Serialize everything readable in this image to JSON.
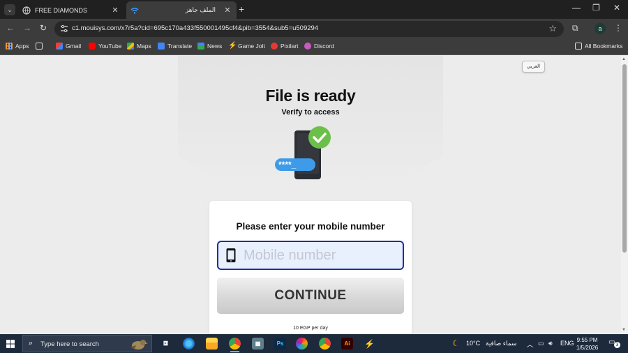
{
  "browser": {
    "tabs": [
      {
        "title": "FREE DIAMONDS",
        "active": false,
        "icon": "globe-icon"
      },
      {
        "title": "الملف جاهز",
        "active": true,
        "icon": "wifi-icon"
      }
    ],
    "url": "c1.mouisys.com/x7r5a?cid=695c170a433f550001495cf4&pib=3554&sub5=u509294",
    "profile_initial": "a",
    "bookmarks": [
      {
        "label": "Apps",
        "icon": "apps-grid-icon"
      },
      {
        "label": "Gmail",
        "icon": "gmail-icon"
      },
      {
        "label": "YouTube",
        "icon": "youtube-icon"
      },
      {
        "label": "Maps",
        "icon": "maps-icon"
      },
      {
        "label": "Translate",
        "icon": "translate-icon"
      },
      {
        "label": "News",
        "icon": "news-icon"
      },
      {
        "label": "Game Jolt",
        "icon": "gamejolt-icon"
      },
      {
        "label": "Pixilart",
        "icon": "pixilart-icon"
      },
      {
        "label": "Discord",
        "icon": "discord-icon"
      }
    ],
    "all_bookmarks_label": "All Bookmarks"
  },
  "page": {
    "language_button": "العربي",
    "title": "File is ready",
    "subtitle": "Verify to access",
    "illustration_password": "****_",
    "form": {
      "heading": "Please enter your mobile number",
      "mobile_placeholder": "Mobile number",
      "mobile_value": "",
      "continue_label": "CONTINUE",
      "price_note": "10 EGP per day"
    },
    "colors": {
      "field_border": "#1f2f9e",
      "field_fill": "#e8f0fe",
      "check_green": "#6cc04a",
      "password_blue": "#3d9be9"
    }
  },
  "taskbar": {
    "search_placeholder": "Type here to search",
    "weather_temp": "10°C",
    "weather_text": "سماء صافية",
    "language": "ENG",
    "time": "9:55 PM",
    "date": "1/5/2026",
    "notification_count": "3"
  }
}
